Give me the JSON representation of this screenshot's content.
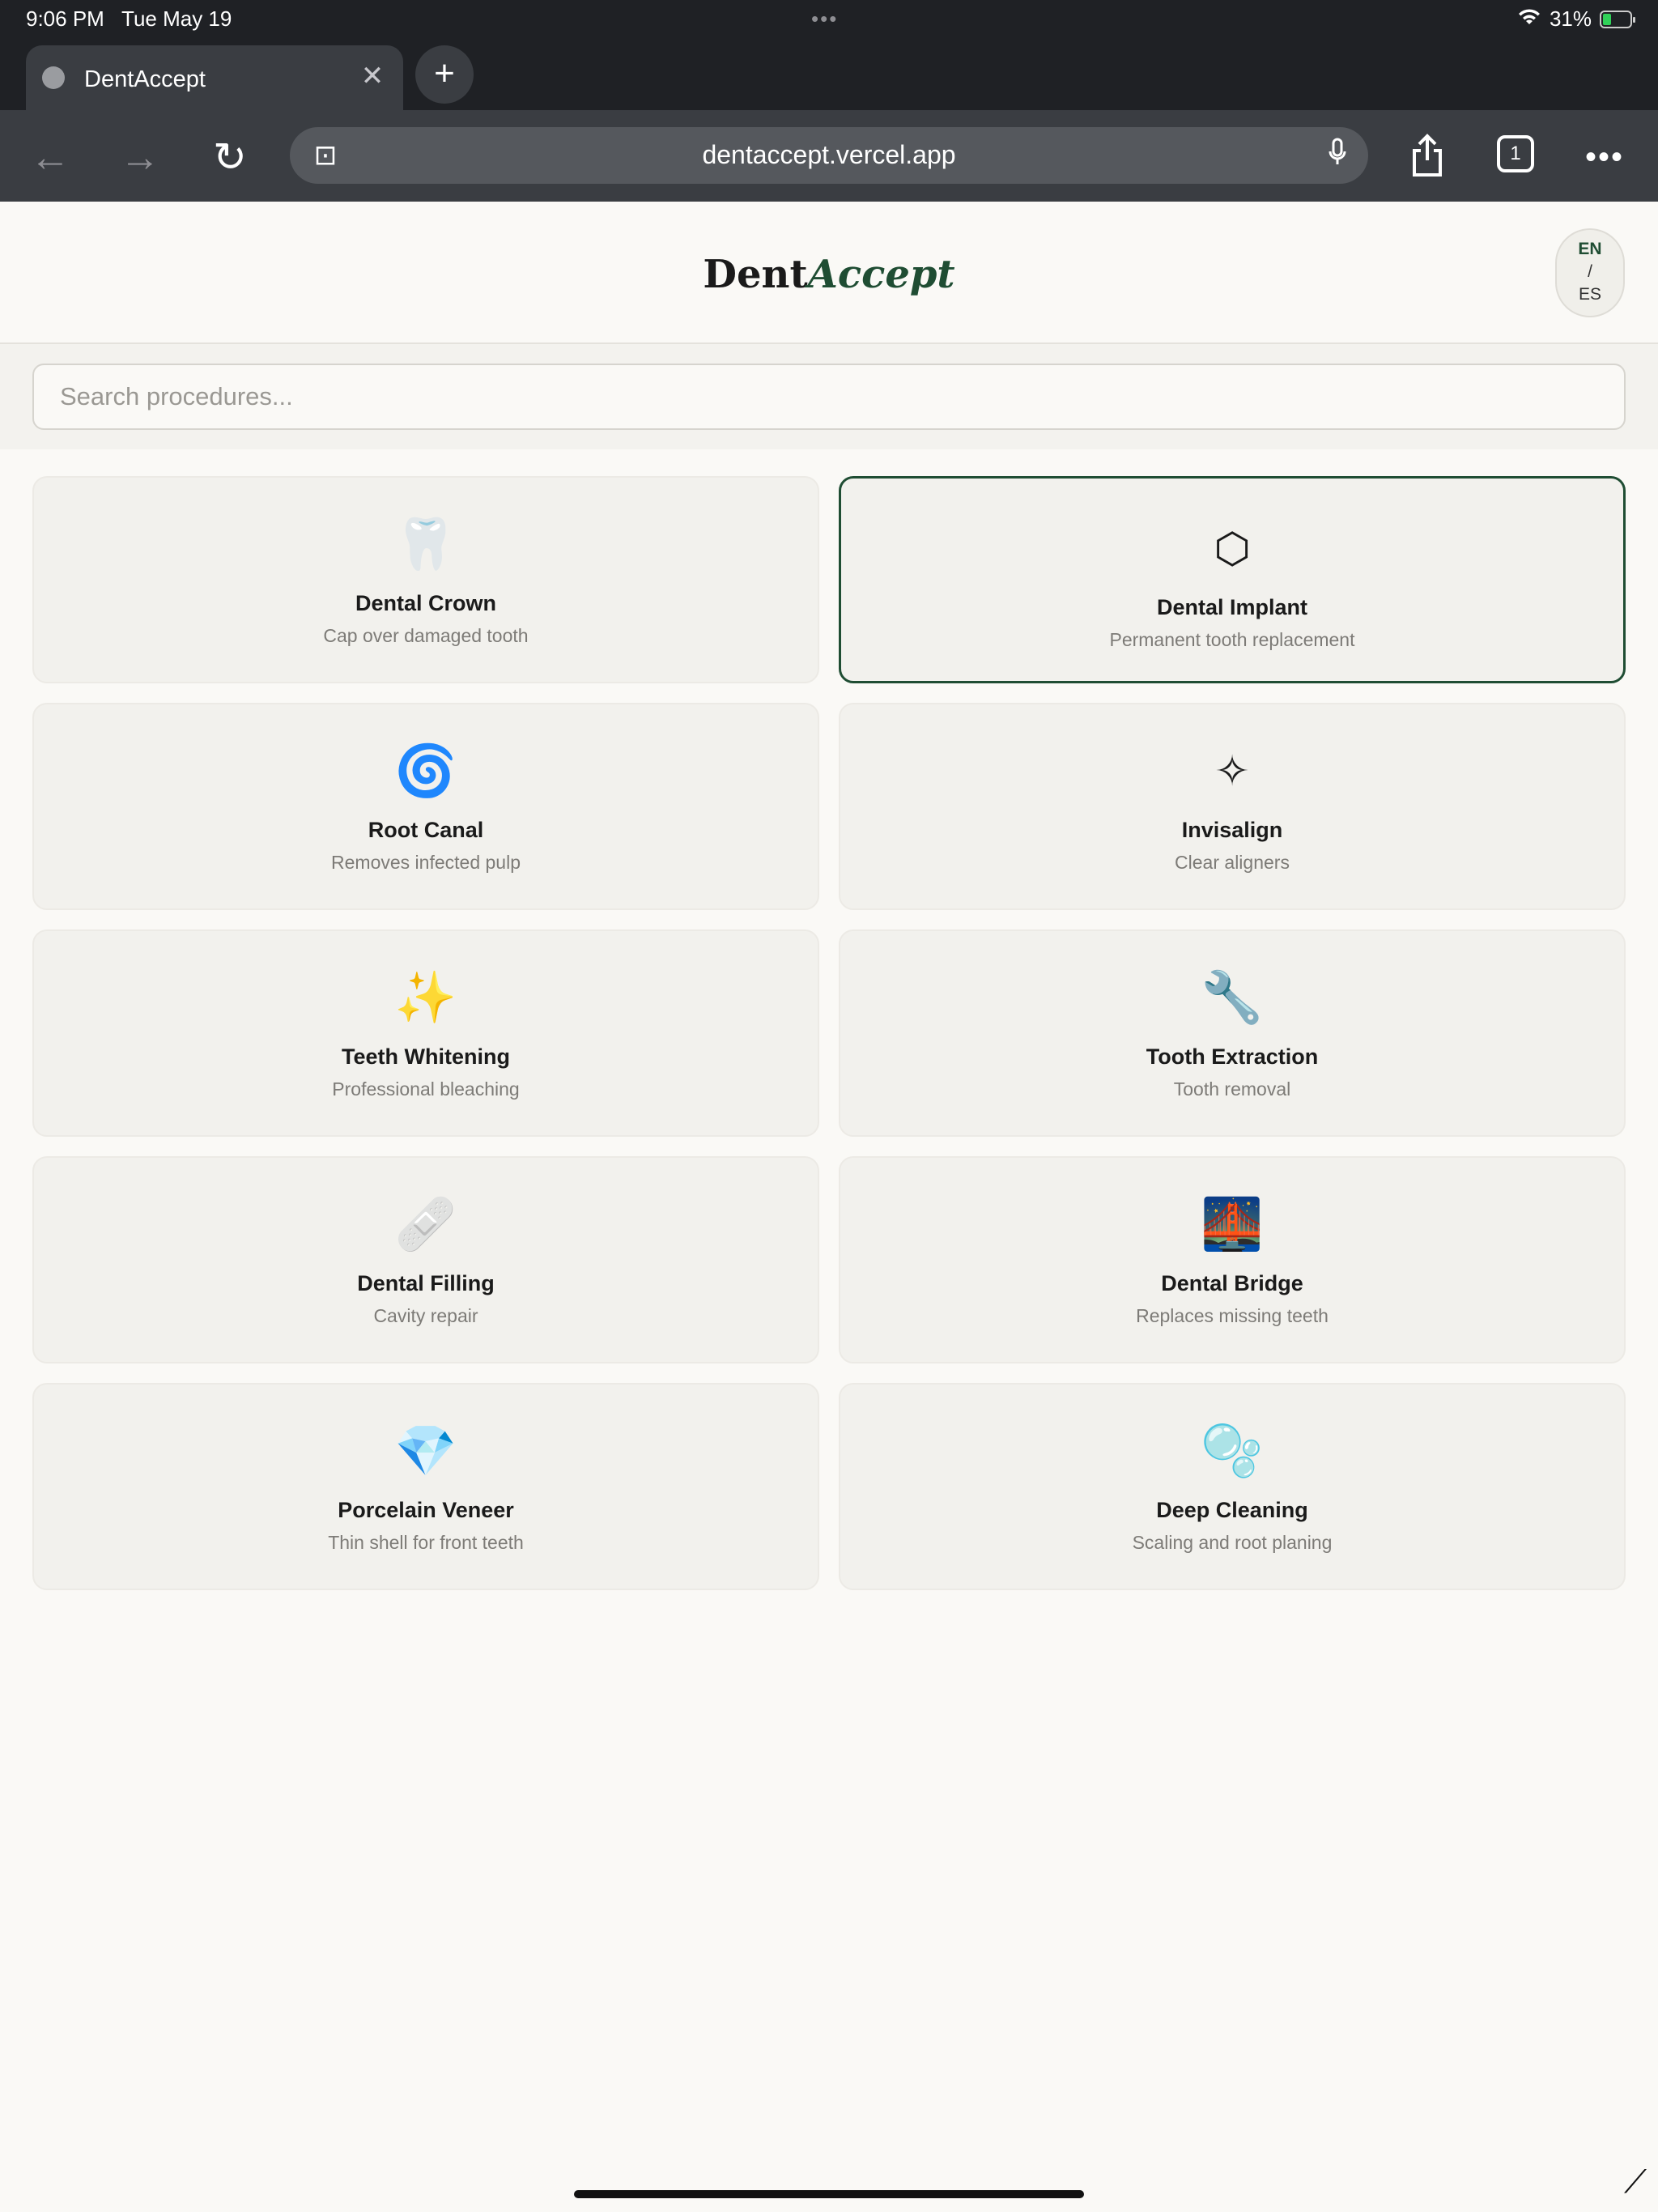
{
  "status_bar": {
    "time": "9:06 PM",
    "date": "Tue May 19",
    "dots": "•••",
    "battery": "31%",
    "battery_level": 0.31
  },
  "browser": {
    "tab_title": "DentAccept",
    "url": "dentaccept.vercel.app",
    "tabs_count": "1"
  },
  "header": {
    "brand_part1": "Dent",
    "brand_part2": "Accept",
    "lang_en": "EN",
    "lang_sep": "/",
    "lang_es": "ES"
  },
  "search": {
    "placeholder": "Search procedures..."
  },
  "procedures": [
    {
      "icon": "🦷",
      "title": "Dental Crown",
      "description": "Cap over damaged tooth"
    },
    {
      "icon": "⬡",
      "title": "Dental Implant",
      "description": "Permanent tooth replacement"
    },
    {
      "icon": "🌀",
      "title": "Root Canal",
      "description": "Removes infected pulp"
    },
    {
      "icon": "✧",
      "title": "Invisalign",
      "description": "Clear aligners"
    },
    {
      "icon": "✨",
      "title": "Teeth Whitening",
      "description": "Professional bleaching"
    },
    {
      "icon": "🔧",
      "title": "Tooth Extraction",
      "description": "Tooth removal"
    },
    {
      "icon": "🩹",
      "title": "Dental Filling",
      "description": "Cavity repair"
    },
    {
      "icon": "🌉",
      "title": "Dental Bridge",
      "description": "Replaces missing teeth"
    },
    {
      "icon": "💎",
      "title": "Porcelain Veneer",
      "description": "Thin shell for front teeth"
    },
    {
      "icon": "🫧",
      "title": "Deep Cleaning",
      "description": "Scaling and root planing"
    }
  ],
  "colors": {
    "accent": "#1f4d33",
    "card_bg": "#f2f1ed",
    "page_bg": "#faf9f6"
  }
}
